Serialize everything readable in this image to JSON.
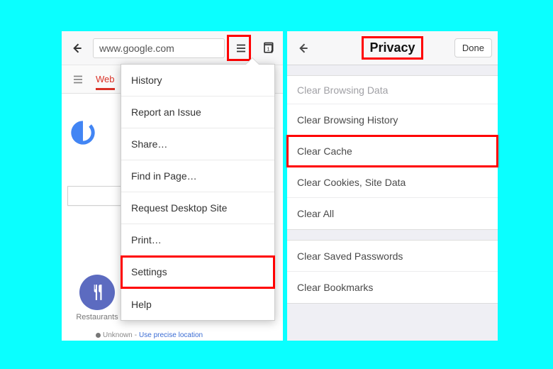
{
  "left": {
    "urlbar": "www.google.com",
    "web_tab": "Web",
    "restaurant_label": "Restaurants",
    "unknown_text": "Unknown",
    "loc_link": "Use precise location",
    "menu": [
      "History",
      "Report an Issue",
      "Share…",
      "Find in Page…",
      "Request Desktop Site",
      "Print…",
      "Settings",
      "Help"
    ],
    "highlight_menu_index": 6,
    "logo_colors": {
      "blue": "#4285F4"
    }
  },
  "right": {
    "title": "Privacy",
    "done": "Done",
    "section1_header": "Clear Browsing Data",
    "section1_rows": [
      "Clear Browsing History",
      "Clear Cache",
      "Clear Cookies, Site Data",
      "Clear All"
    ],
    "section1_highlight_index": 1,
    "section2_rows": [
      "Clear Saved Passwords",
      "Clear Bookmarks"
    ]
  },
  "colors": {
    "highlight": "#ff0000",
    "accent": "#d93025"
  }
}
